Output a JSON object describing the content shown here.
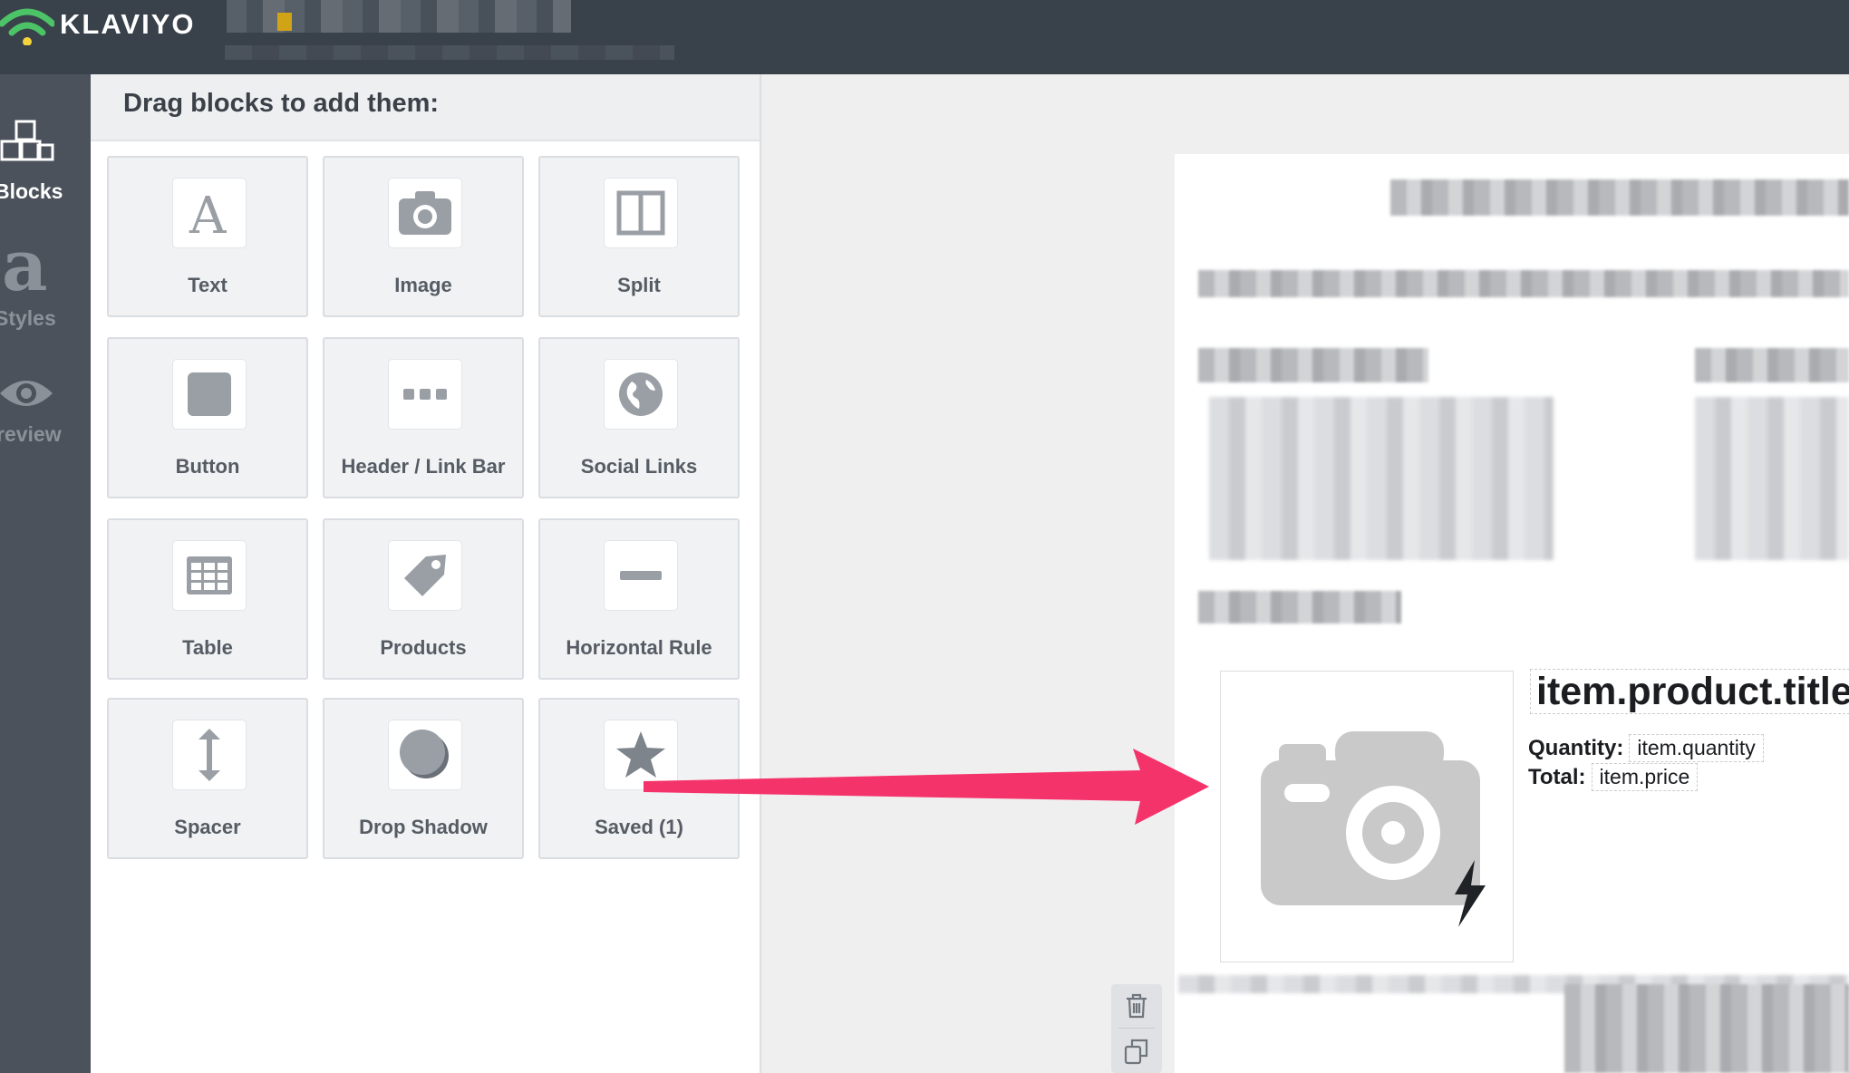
{
  "topbar": {
    "brand": "KLAVIYO",
    "brand_color": "#ffffff",
    "icon_colors": {
      "outer": "#4cc366",
      "inner": "#f5d33b"
    }
  },
  "rail": {
    "items": [
      {
        "label": "Blocks",
        "icon": "blocks-icon",
        "active": true
      },
      {
        "label": "Styles",
        "icon": "styles-icon",
        "active": false
      },
      {
        "label": "review",
        "icon": "eye-icon",
        "active": false
      }
    ]
  },
  "panel": {
    "title": "Drag blocks to add them:",
    "blocks": [
      {
        "label": "Text",
        "icon": "text-icon"
      },
      {
        "label": "Image",
        "icon": "camera-icon"
      },
      {
        "label": "Split",
        "icon": "split-icon"
      },
      {
        "label": "Button",
        "icon": "button-icon"
      },
      {
        "label": "Header / Link Bar",
        "icon": "dots-icon"
      },
      {
        "label": "Social Links",
        "icon": "globe-icon"
      },
      {
        "label": "Table",
        "icon": "table-icon"
      },
      {
        "label": "Products",
        "icon": "tag-icon"
      },
      {
        "label": "Horizontal Rule",
        "icon": "rule-icon"
      },
      {
        "label": "Spacer",
        "icon": "spacer-icon"
      },
      {
        "label": "Drop Shadow",
        "icon": "shadow-icon"
      },
      {
        "label": "Saved (1)",
        "icon": "star-icon"
      }
    ]
  },
  "product": {
    "title": "item.product.title",
    "quantity_label": "Quantity:",
    "quantity_value": "item.quantity",
    "total_label": "Total:",
    "total_value": "item.price"
  },
  "colors": {
    "arrow": "#f5336b",
    "accent_text": "#3b4148"
  }
}
